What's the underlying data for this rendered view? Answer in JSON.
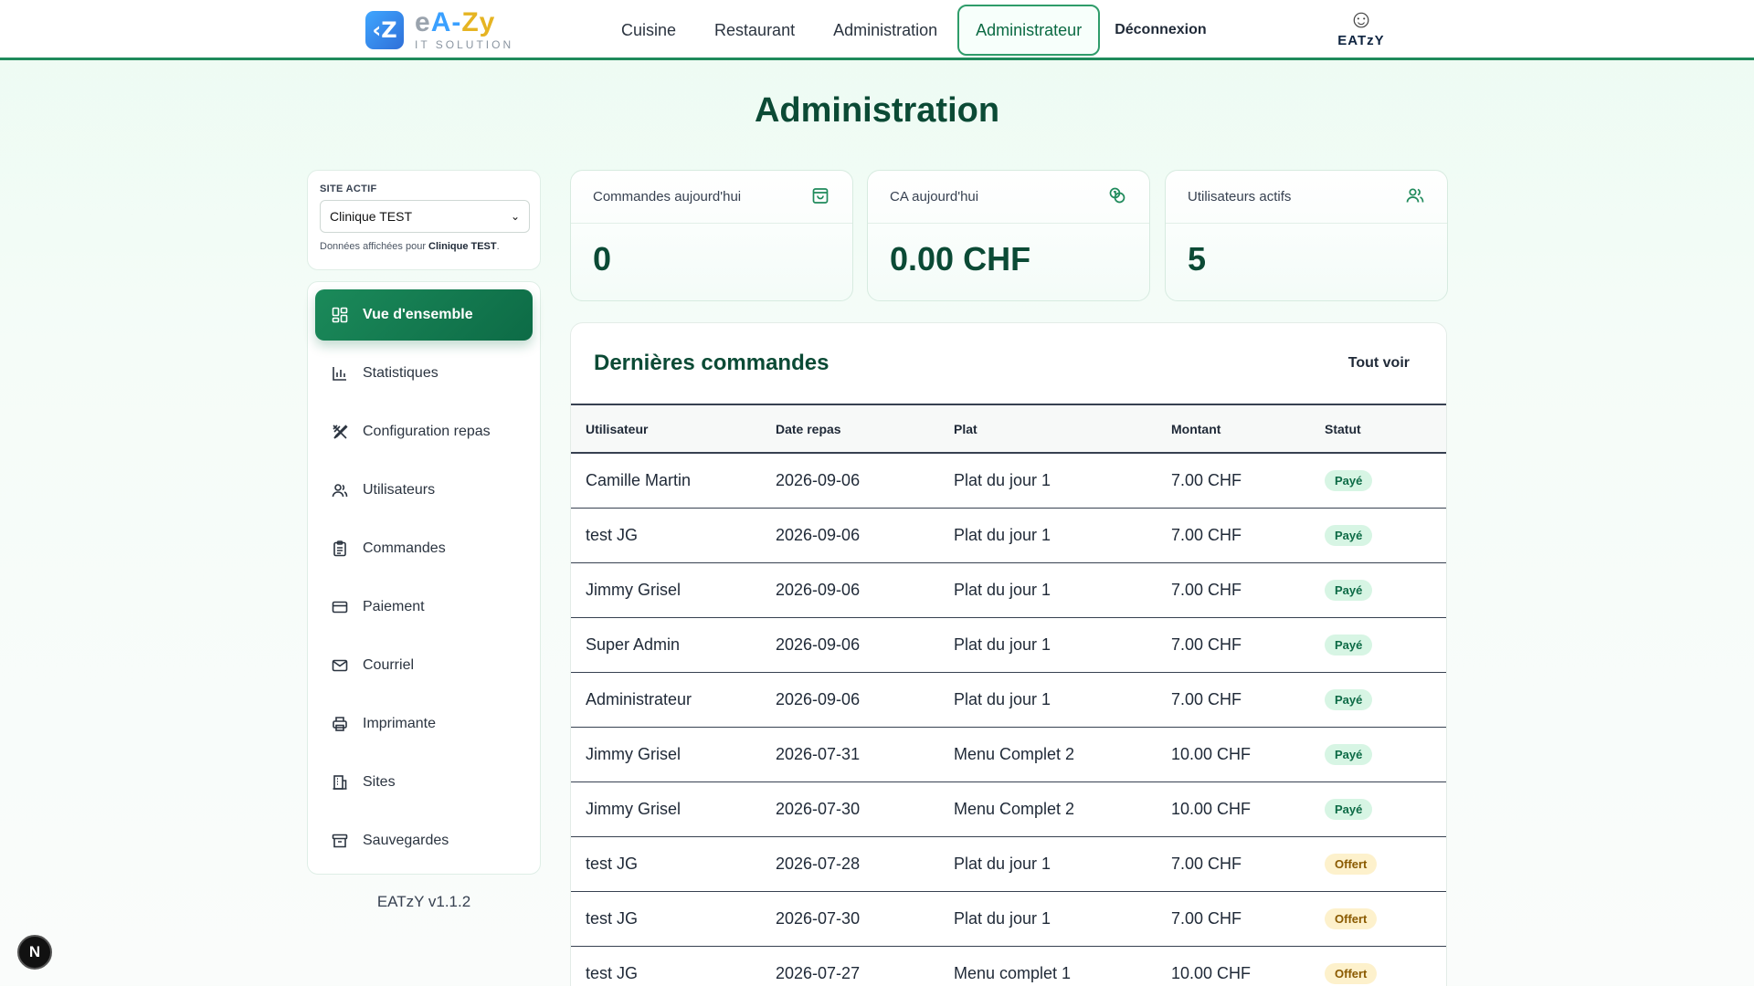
{
  "header": {
    "logo_mark": "‹Z",
    "logo_name_a": "e",
    "logo_name_b": "A-",
    "logo_name_c": "Zy",
    "logo_sub": "IT SOLUTION",
    "nav": [
      {
        "label": "Cuisine"
      },
      {
        "label": "Restaurant"
      },
      {
        "label": "Administration"
      },
      {
        "label": "Administrateur",
        "active": true
      }
    ],
    "logout": "Déconnexion",
    "brand": "EATzY",
    "brand_icon": "chef-icon"
  },
  "page": {
    "title": "Administration"
  },
  "site": {
    "label": "SITE ACTIF",
    "selected": "Clinique TEST",
    "hint_prefix": "Données affichées pour ",
    "hint_site": "Clinique TEST",
    "hint_suffix": "."
  },
  "menu": [
    {
      "label": "Vue d'ensemble",
      "icon": "grid-icon",
      "active": true
    },
    {
      "label": "Statistiques",
      "icon": "bar-chart-icon"
    },
    {
      "label": "Configuration repas",
      "icon": "utensils-icon"
    },
    {
      "label": "Utilisateurs",
      "icon": "users-icon"
    },
    {
      "label": "Commandes",
      "icon": "clipboard-icon"
    },
    {
      "label": "Paiement",
      "icon": "credit-card-icon"
    },
    {
      "label": "Courriel",
      "icon": "mail-icon"
    },
    {
      "label": "Imprimante",
      "icon": "printer-icon"
    },
    {
      "label": "Sites",
      "icon": "building-icon"
    },
    {
      "label": "Sauvegardes",
      "icon": "archive-icon"
    }
  ],
  "version": "EATzY v1.1.2",
  "stats": [
    {
      "label": "Commandes aujourd'hui",
      "value": "0",
      "icon": "shopping-bag-icon"
    },
    {
      "label": "CA aujourd'hui",
      "value": "0.00 CHF",
      "icon": "coins-icon"
    },
    {
      "label": "Utilisateurs actifs",
      "value": "5",
      "icon": "users-icon"
    }
  ],
  "orders": {
    "title": "Dernières commandes",
    "see_all": "Tout voir",
    "columns": [
      "Utilisateur",
      "Date repas",
      "Plat",
      "Montant",
      "Statut"
    ],
    "rows": [
      {
        "user": "Camille Martin",
        "date": "2026-09-06",
        "dish": "Plat du jour 1",
        "amount": "7.00 CHF",
        "status": "Payé",
        "kind": "paid"
      },
      {
        "user": "test JG",
        "date": "2026-09-06",
        "dish": "Plat du jour 1",
        "amount": "7.00 CHF",
        "status": "Payé",
        "kind": "paid"
      },
      {
        "user": "Jimmy Grisel",
        "date": "2026-09-06",
        "dish": "Plat du jour 1",
        "amount": "7.00 CHF",
        "status": "Payé",
        "kind": "paid"
      },
      {
        "user": "Super Admin",
        "date": "2026-09-06",
        "dish": "Plat du jour 1",
        "amount": "7.00 CHF",
        "status": "Payé",
        "kind": "paid"
      },
      {
        "user": "Administrateur",
        "date": "2026-09-06",
        "dish": "Plat du jour 1",
        "amount": "7.00 CHF",
        "status": "Payé",
        "kind": "paid"
      },
      {
        "user": "Jimmy Grisel",
        "date": "2026-07-31",
        "dish": "Menu Complet 2",
        "amount": "10.00 CHF",
        "status": "Payé",
        "kind": "paid"
      },
      {
        "user": "Jimmy Grisel",
        "date": "2026-07-30",
        "dish": "Menu Complet 2",
        "amount": "10.00 CHF",
        "status": "Payé",
        "kind": "paid"
      },
      {
        "user": "test JG",
        "date": "2026-07-28",
        "dish": "Plat du jour 1",
        "amount": "7.00 CHF",
        "status": "Offert",
        "kind": "offered"
      },
      {
        "user": "test JG",
        "date": "2026-07-30",
        "dish": "Plat du jour 1",
        "amount": "7.00 CHF",
        "status": "Offert",
        "kind": "offered"
      },
      {
        "user": "test JG",
        "date": "2026-07-27",
        "dish": "Menu complet 1",
        "amount": "10.00 CHF",
        "status": "Offert",
        "kind": "offered"
      }
    ]
  },
  "fab": {
    "label": "N"
  },
  "colors": {
    "primary": "#0d6b46",
    "accent_border": "#1f8a5b",
    "paid_bg": "#d7f5e4",
    "offered_bg": "#fdf1cc"
  }
}
